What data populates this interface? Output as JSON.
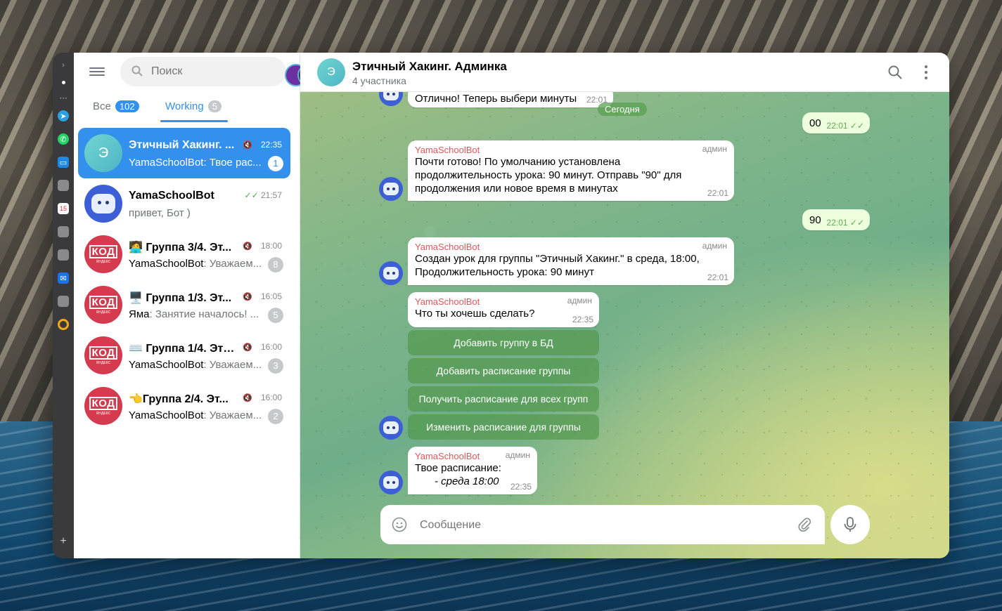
{
  "sidebar": {
    "search_placeholder": "Поиск",
    "tabs": [
      {
        "label": "Все",
        "count": "102"
      },
      {
        "label": "Working",
        "count": "5"
      }
    ],
    "chats": [
      {
        "name": "Этичный Хакинг. ...",
        "time": "22:35",
        "preview": "YamaSchoolBot: Твое рас...",
        "badge": "1",
        "muted": true
      },
      {
        "name": "YamaSchoolBot",
        "time": "21:57",
        "preview": "привет, Бот )",
        "read": true
      },
      {
        "name": "🧑‍💻 Группа 3/4. Эт...",
        "time": "18:00",
        "sender": "YamaSchoolBot",
        "preview": ": Уважаем...",
        "badge": "8",
        "muted": true
      },
      {
        "name": "🖥️ Группа 1/3. Эт...",
        "time": "16:05",
        "sender": "Яма",
        "preview": ": Занятие началось! ...",
        "badge": "5",
        "muted": true
      },
      {
        "name": "⌨️ Группа 1/4. Этич...",
        "time": "16:00",
        "sender": "YamaSchoolBot",
        "preview": ": Уважаем...",
        "badge": "3",
        "muted": true
      },
      {
        "name": "👈Группа 2/4. Эт...",
        "time": "16:00",
        "sender": "YamaSchoolBot",
        "preview": ": Уважаем...",
        "badge": "2",
        "muted": true
      }
    ],
    "avatar_letter": "Э",
    "kod_text": "КОД",
    "kod_sub": "ЯНДЕКС"
  },
  "header": {
    "title": "Этичный Хакинг. Админка",
    "subtitle": "4 участника",
    "avatar_letter": "Э"
  },
  "messages": {
    "m0": {
      "text": "Отлично! Теперь выбери минуты",
      "time": "22:01"
    },
    "date": "Сегодня",
    "out1": {
      "text": "00",
      "time": "22:01"
    },
    "m1": {
      "author": "YamaSchoolBot",
      "role": "админ",
      "text": "Почти готово! По умолчанию установлена продолжительность урока: 90 минут. Отправь \"90\" для продолжения или новое время в минутах",
      "time": "22:01"
    },
    "out2": {
      "text": "90",
      "time": "22:01"
    },
    "m2": {
      "author": "YamaSchoolBot",
      "role": "админ",
      "text": "Создан урок для группы \"Этичный Хакинг.\" в среда, 18:00, Продолжительность урока: 90 минут",
      "time": "22:01"
    },
    "m3": {
      "author": "YamaSchoolBot",
      "role": "админ",
      "text": "Что ты хочешь сделать?",
      "time": "22:35"
    },
    "buttons": [
      "Добавить группу в БД",
      "Добавить расписание группы",
      "Получить расписание для всех групп",
      "Изменить расписание для группы"
    ],
    "m4": {
      "author": "YamaSchoolBot",
      "role": "админ",
      "text": "Твое расписание:",
      "text2": "- среда 18:00",
      "time": "22:35"
    }
  },
  "composer": {
    "placeholder": "Сообщение"
  },
  "colors": {
    "accent": "#3390ec",
    "author": "#e1575c",
    "out_bubble": "#eeffde",
    "kod_red": "#d63a4e"
  }
}
